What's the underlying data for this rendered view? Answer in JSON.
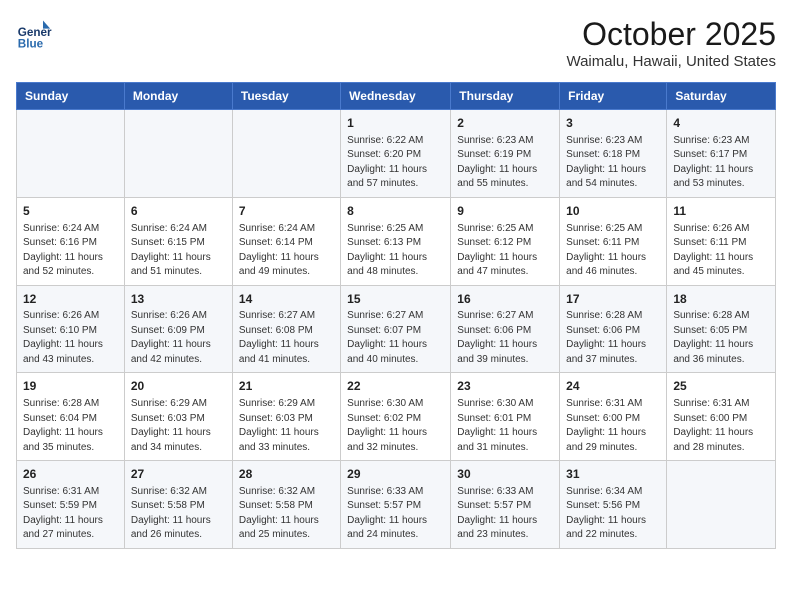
{
  "header": {
    "logo_general": "General",
    "logo_blue": "Blue",
    "title": "October 2025",
    "subtitle": "Waimalu, Hawaii, United States"
  },
  "columns": [
    "Sunday",
    "Monday",
    "Tuesday",
    "Wednesday",
    "Thursday",
    "Friday",
    "Saturday"
  ],
  "weeks": [
    [
      {
        "num": "",
        "info": ""
      },
      {
        "num": "",
        "info": ""
      },
      {
        "num": "",
        "info": ""
      },
      {
        "num": "1",
        "info": "Sunrise: 6:22 AM\nSunset: 6:20 PM\nDaylight: 11 hours and 57 minutes."
      },
      {
        "num": "2",
        "info": "Sunrise: 6:23 AM\nSunset: 6:19 PM\nDaylight: 11 hours and 55 minutes."
      },
      {
        "num": "3",
        "info": "Sunrise: 6:23 AM\nSunset: 6:18 PM\nDaylight: 11 hours and 54 minutes."
      },
      {
        "num": "4",
        "info": "Sunrise: 6:23 AM\nSunset: 6:17 PM\nDaylight: 11 hours and 53 minutes."
      }
    ],
    [
      {
        "num": "5",
        "info": "Sunrise: 6:24 AM\nSunset: 6:16 PM\nDaylight: 11 hours and 52 minutes."
      },
      {
        "num": "6",
        "info": "Sunrise: 6:24 AM\nSunset: 6:15 PM\nDaylight: 11 hours and 51 minutes."
      },
      {
        "num": "7",
        "info": "Sunrise: 6:24 AM\nSunset: 6:14 PM\nDaylight: 11 hours and 49 minutes."
      },
      {
        "num": "8",
        "info": "Sunrise: 6:25 AM\nSunset: 6:13 PM\nDaylight: 11 hours and 48 minutes."
      },
      {
        "num": "9",
        "info": "Sunrise: 6:25 AM\nSunset: 6:12 PM\nDaylight: 11 hours and 47 minutes."
      },
      {
        "num": "10",
        "info": "Sunrise: 6:25 AM\nSunset: 6:11 PM\nDaylight: 11 hours and 46 minutes."
      },
      {
        "num": "11",
        "info": "Sunrise: 6:26 AM\nSunset: 6:11 PM\nDaylight: 11 hours and 45 minutes."
      }
    ],
    [
      {
        "num": "12",
        "info": "Sunrise: 6:26 AM\nSunset: 6:10 PM\nDaylight: 11 hours and 43 minutes."
      },
      {
        "num": "13",
        "info": "Sunrise: 6:26 AM\nSunset: 6:09 PM\nDaylight: 11 hours and 42 minutes."
      },
      {
        "num": "14",
        "info": "Sunrise: 6:27 AM\nSunset: 6:08 PM\nDaylight: 11 hours and 41 minutes."
      },
      {
        "num": "15",
        "info": "Sunrise: 6:27 AM\nSunset: 6:07 PM\nDaylight: 11 hours and 40 minutes."
      },
      {
        "num": "16",
        "info": "Sunrise: 6:27 AM\nSunset: 6:06 PM\nDaylight: 11 hours and 39 minutes."
      },
      {
        "num": "17",
        "info": "Sunrise: 6:28 AM\nSunset: 6:06 PM\nDaylight: 11 hours and 37 minutes."
      },
      {
        "num": "18",
        "info": "Sunrise: 6:28 AM\nSunset: 6:05 PM\nDaylight: 11 hours and 36 minutes."
      }
    ],
    [
      {
        "num": "19",
        "info": "Sunrise: 6:28 AM\nSunset: 6:04 PM\nDaylight: 11 hours and 35 minutes."
      },
      {
        "num": "20",
        "info": "Sunrise: 6:29 AM\nSunset: 6:03 PM\nDaylight: 11 hours and 34 minutes."
      },
      {
        "num": "21",
        "info": "Sunrise: 6:29 AM\nSunset: 6:03 PM\nDaylight: 11 hours and 33 minutes."
      },
      {
        "num": "22",
        "info": "Sunrise: 6:30 AM\nSunset: 6:02 PM\nDaylight: 11 hours and 32 minutes."
      },
      {
        "num": "23",
        "info": "Sunrise: 6:30 AM\nSunset: 6:01 PM\nDaylight: 11 hours and 31 minutes."
      },
      {
        "num": "24",
        "info": "Sunrise: 6:31 AM\nSunset: 6:00 PM\nDaylight: 11 hours and 29 minutes."
      },
      {
        "num": "25",
        "info": "Sunrise: 6:31 AM\nSunset: 6:00 PM\nDaylight: 11 hours and 28 minutes."
      }
    ],
    [
      {
        "num": "26",
        "info": "Sunrise: 6:31 AM\nSunset: 5:59 PM\nDaylight: 11 hours and 27 minutes."
      },
      {
        "num": "27",
        "info": "Sunrise: 6:32 AM\nSunset: 5:58 PM\nDaylight: 11 hours and 26 minutes."
      },
      {
        "num": "28",
        "info": "Sunrise: 6:32 AM\nSunset: 5:58 PM\nDaylight: 11 hours and 25 minutes."
      },
      {
        "num": "29",
        "info": "Sunrise: 6:33 AM\nSunset: 5:57 PM\nDaylight: 11 hours and 24 minutes."
      },
      {
        "num": "30",
        "info": "Sunrise: 6:33 AM\nSunset: 5:57 PM\nDaylight: 11 hours and 23 minutes."
      },
      {
        "num": "31",
        "info": "Sunrise: 6:34 AM\nSunset: 5:56 PM\nDaylight: 11 hours and 22 minutes."
      },
      {
        "num": "",
        "info": ""
      }
    ]
  ]
}
